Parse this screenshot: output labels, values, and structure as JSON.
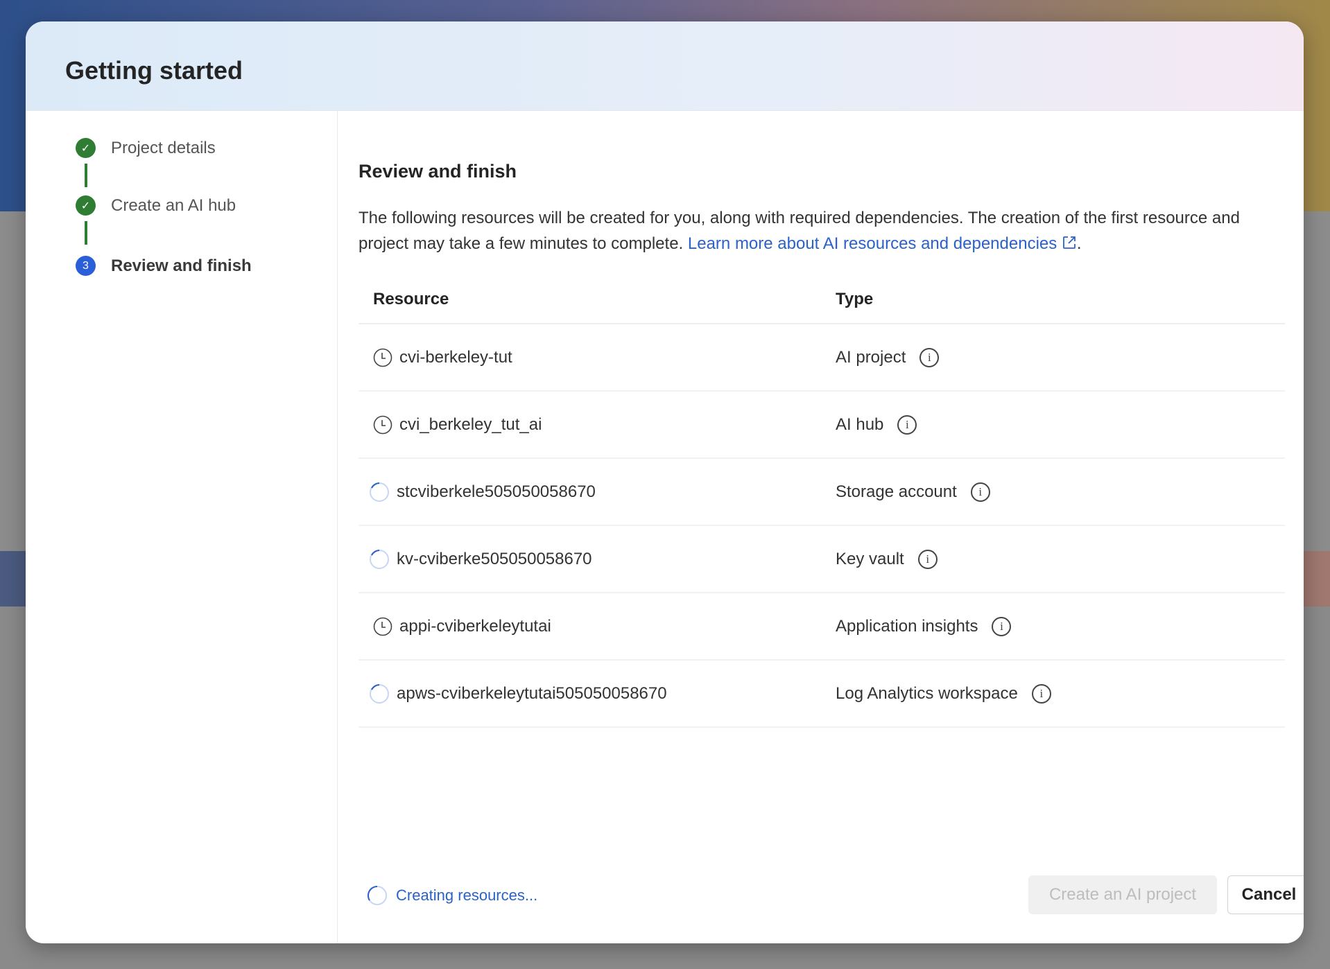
{
  "dialog": {
    "title": "Getting started"
  },
  "steps": [
    {
      "label": "Project details",
      "state": "done"
    },
    {
      "label": "Create an AI hub",
      "state": "done"
    },
    {
      "label": "Review and finish",
      "state": "current",
      "number": "3"
    }
  ],
  "review": {
    "heading": "Review and finish",
    "description": "The following resources will be created for you, along with required dependencies. The creation of the first resource and project may take a few minutes to complete. ",
    "link_text": "Learn more about AI resources and dependencies",
    "link_suffix": ".",
    "columns": {
      "resource": "Resource",
      "type": "Type"
    },
    "rows": [
      {
        "name": "cvi-berkeley-tut",
        "type": "AI project",
        "status": "pending"
      },
      {
        "name": "cvi_berkeley_tut_ai",
        "type": "AI hub",
        "status": "pending"
      },
      {
        "name": "stcviberkele505050058670",
        "type": "Storage account",
        "status": "in-progress"
      },
      {
        "name": "kv-cviberke505050058670",
        "type": "Key vault",
        "status": "in-progress"
      },
      {
        "name": "appi-cviberkeleytutai",
        "type": "Application insights",
        "status": "pending"
      },
      {
        "name": "apws-cviberkeleytutai505050058670",
        "type": "Log Analytics workspace",
        "status": "in-progress"
      }
    ]
  },
  "footer": {
    "status": "Creating resources...",
    "create_label": "Create an AI project",
    "cancel_label": "Cancel"
  },
  "colors": {
    "accent": "#2b62c9",
    "success": "#2f7d32",
    "step_current": "#2b5fd9"
  }
}
